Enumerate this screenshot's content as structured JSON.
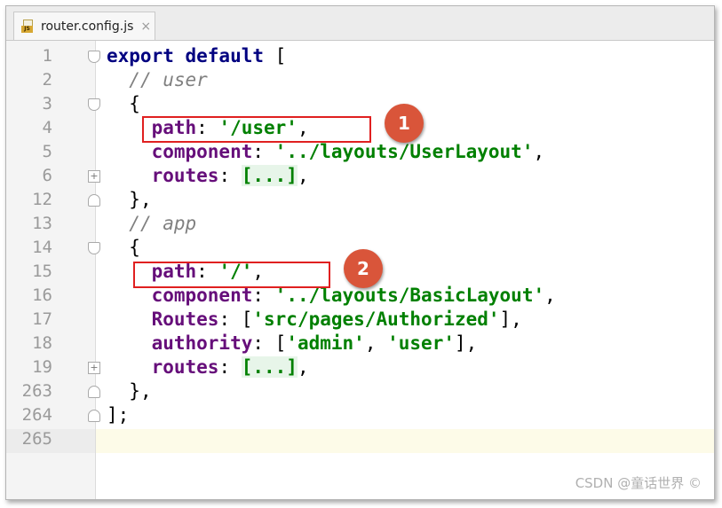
{
  "tab": {
    "filename": "router.config.js",
    "close": "×",
    "icon": "js-file-icon",
    "icon_badge": "JS"
  },
  "gutter": {
    "numbers": [
      "1",
      "2",
      "3",
      "4",
      "5",
      "6",
      "12",
      "13",
      "14",
      "15",
      "16",
      "17",
      "18",
      "19",
      "263",
      "264",
      "265"
    ]
  },
  "code": {
    "l1": {
      "kw": "export default",
      "rest": " ["
    },
    "l2": {
      "comment": "// user"
    },
    "l3": {
      "text": "{"
    },
    "l4": {
      "prop": "path",
      "colon": ": ",
      "str": "'/user'",
      "end": ","
    },
    "l5": {
      "prop": "component",
      "colon": ": ",
      "str": "'../layouts/UserLayout'",
      "end": ","
    },
    "l6": {
      "prop": "routes",
      "colon": ": ",
      "collapsed": "[...]",
      "end": ","
    },
    "l12": {
      "text": "},"
    },
    "l13": {
      "comment": "// app"
    },
    "l14": {
      "text": "{"
    },
    "l15": {
      "prop": "path",
      "colon": ": ",
      "str": "'/'",
      "end": ","
    },
    "l16": {
      "prop": "component",
      "colon": ": ",
      "str": "'../layouts/BasicLayout'",
      "end": ","
    },
    "l17": {
      "prop": "Routes",
      "colon": ": [",
      "str": "'src/pages/Authorized'",
      "end": "],"
    },
    "l18": {
      "prop": "authority",
      "colon": ": [",
      "str1": "'admin'",
      "sep": ", ",
      "str2": "'user'",
      "end": "],"
    },
    "l19": {
      "prop": "routes",
      "colon": ": ",
      "collapsed": "[...]",
      "end": ","
    },
    "l263": {
      "text": "},"
    },
    "l264": {
      "text": "];"
    }
  },
  "annotations": {
    "marker1": "1",
    "marker2": "2"
  },
  "watermark": "CSDN @童话世界 ©",
  "colors": {
    "keyword": "#000080",
    "property": "#660e7a",
    "string": "#008000",
    "comment": "#808080",
    "annotation_box": "#e02020",
    "marker": "#d9553a"
  }
}
